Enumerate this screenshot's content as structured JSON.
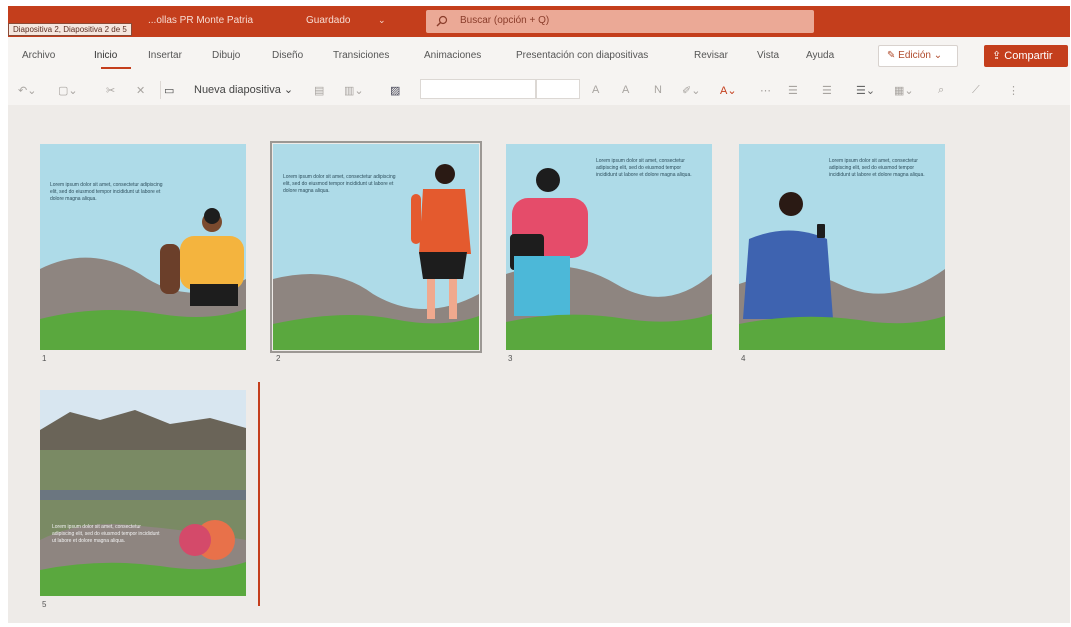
{
  "titlebar": {
    "tooltip": "Diapositiva 2, Diapositiva 2 de 5",
    "doc_title": "...ollas PR Monte Patria",
    "saved_label": "Guardado",
    "search_placeholder": "Buscar (opción + Q)"
  },
  "menu": {
    "tabs": [
      "Archivo",
      "Inicio",
      "Insertar",
      "Dibujo",
      "Diseño",
      "Transiciones",
      "Animaciones",
      "Presentación con diapositivas",
      "Revisar",
      "Vista",
      "Ayuda"
    ],
    "active_tab": "Inicio",
    "edit_mode_label": "Edición",
    "share_label": "Compartir"
  },
  "toolbar": {
    "new_slide_label": "Nueva diapositiva"
  },
  "slides": [
    {
      "number": "1",
      "text": "Lorem ipsum dolor sit amet, consectetur adipiscing elit, sed do eiusmod tempor incididunt ut labore et dolore magna aliqua."
    },
    {
      "number": "2",
      "text": "Lorem ipsum dolor sit amet, consectetur adipiscing elit, sed do eiusmod tempor incididunt ut labore et dolore magna aliqua."
    },
    {
      "number": "3",
      "text": "Lorem ipsum dolor sit amet, consectetur adipiscing elit, sed do eiusmod tempor incididunt ut labore et dolore magna aliqua."
    },
    {
      "number": "4",
      "text": "Lorem ipsum dolor sit amet, consectetur adipiscing elit, sed do eiusmod tempor incididunt ut labore et dolore magna aliqua."
    },
    {
      "number": "5",
      "text": "Lorem ipsum dolor sit amet, consectetur adipiscing elit, sed do eiusmod tempor incididunt ut labore et dolore magna aliqua."
    }
  ],
  "selected_slide": "2",
  "colors": {
    "brand": "#c43e1c",
    "slide_bg": "#aedbe8",
    "hill": "#8e8580",
    "grass": "#5aa83e"
  }
}
